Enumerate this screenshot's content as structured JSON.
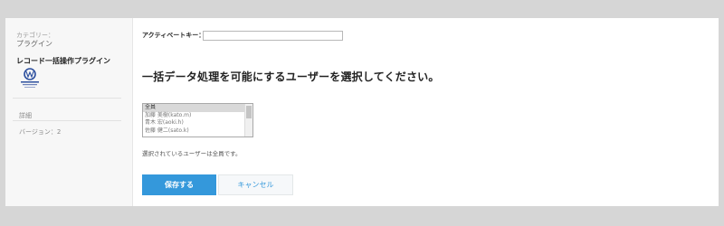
{
  "sidebar": {
    "category_label": "カテゴリー：",
    "category_value": "プラグイン",
    "plugin_name": "レコード一括操作プラグイン",
    "detail_link": "詳細",
    "version": "バージョン：2"
  },
  "form": {
    "activate_key_label": "アクティベートキー：",
    "activate_key_value": "",
    "heading": "一括データ処理を可能にするユーザーを選択してください。",
    "users": [
      "全員",
      "加藤 美樹(kato.m)",
      "青木 宏(aoki.h)",
      "佐藤 健二(sato.k)"
    ],
    "selected_user": "全員",
    "selected_text": "選択されているユーザーは全員です。"
  },
  "buttons": {
    "save": "保存する",
    "cancel": "キャンセル"
  },
  "colors": {
    "primary": "#3498db",
    "background": "#d6d6d6"
  }
}
